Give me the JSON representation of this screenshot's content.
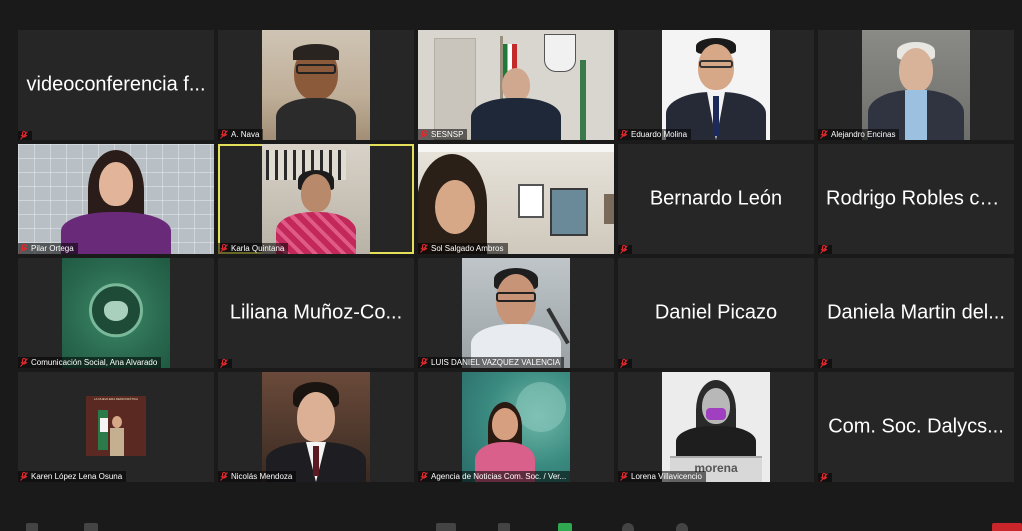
{
  "participants": [
    {
      "name": "videoconferencia f...",
      "type": "text"
    },
    {
      "name": "A. Nava",
      "type": "video"
    },
    {
      "name": "SESNSP",
      "type": "video"
    },
    {
      "name": "Eduardo Molina",
      "type": "video"
    },
    {
      "name": "Alejandro Encinas",
      "type": "video"
    },
    {
      "name": "Pilar Ortega",
      "type": "video"
    },
    {
      "name": "Karla Quintana",
      "type": "video",
      "active": true
    },
    {
      "name": "Sol Salgado Ambros",
      "type": "video"
    },
    {
      "name": "Bernardo León",
      "type": "text"
    },
    {
      "name": "Rodrigo Robles co...",
      "type": "text"
    },
    {
      "name": "Comunicación Social, Ana Alvarado",
      "type": "video"
    },
    {
      "name": "Liliana Muñoz-Co...",
      "type": "text"
    },
    {
      "name": "LUIS DANIEL VAZQUEZ VALENCIA",
      "type": "video"
    },
    {
      "name": "Daniel Picazo",
      "type": "text"
    },
    {
      "name": "Daniela Martin del...",
      "type": "text"
    },
    {
      "name": "Karen López Lena Osuna",
      "type": "video"
    },
    {
      "name": "Nicolás Mendoza",
      "type": "video"
    },
    {
      "name": "Agencia de Noticias Com. Soc. / Ver...",
      "type": "video"
    },
    {
      "name": "Lorena Villavicencio",
      "type": "video"
    },
    {
      "name": "Com. Soc. Dalycs...",
      "type": "text"
    }
  ],
  "overlay_text": {
    "morena_podium": "morena",
    "banner_small": "LA NUEVA ERA DEMOCRÁTICA"
  },
  "colors": {
    "background": "#1a1a1a",
    "tile": "#262626",
    "active_border": "#e5e05a",
    "muted_icon": "#e0282e"
  }
}
